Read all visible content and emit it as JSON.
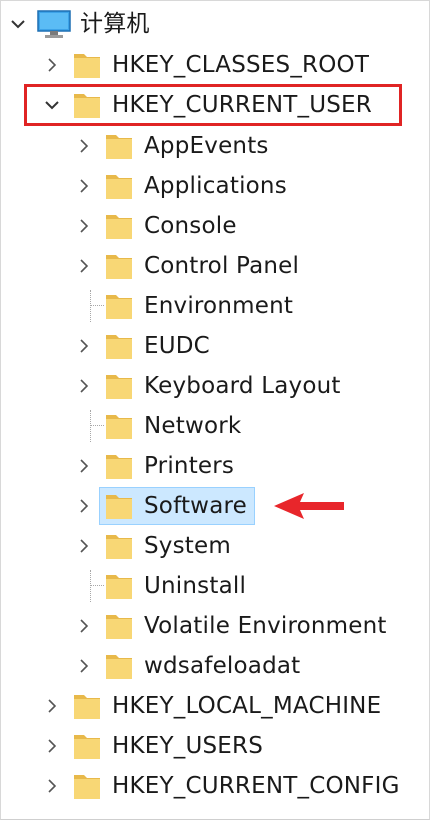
{
  "tree": {
    "root": {
      "label": "计算机",
      "icon": "computer-icon",
      "expanded": true
    },
    "hives": [
      {
        "label": "HKEY_CLASSES_ROOT",
        "expanded": false
      },
      {
        "label": "HKEY_CURRENT_USER",
        "expanded": true,
        "highlighted": true
      },
      {
        "label": "HKEY_LOCAL_MACHINE",
        "expanded": false
      },
      {
        "label": "HKEY_USERS",
        "expanded": false
      },
      {
        "label": "HKEY_CURRENT_CONFIG",
        "expanded": false
      }
    ],
    "current_user_children": [
      {
        "label": "AppEvents",
        "has_children": true
      },
      {
        "label": "Applications",
        "has_children": true
      },
      {
        "label": "Console",
        "has_children": true
      },
      {
        "label": "Control Panel",
        "has_children": true
      },
      {
        "label": "Environment",
        "has_children": false
      },
      {
        "label": "EUDC",
        "has_children": true
      },
      {
        "label": "Keyboard Layout",
        "has_children": true
      },
      {
        "label": "Network",
        "has_children": false
      },
      {
        "label": "Printers",
        "has_children": true
      },
      {
        "label": "Software",
        "has_children": true,
        "selected": true
      },
      {
        "label": "System",
        "has_children": true
      },
      {
        "label": "Uninstall",
        "has_children": false
      },
      {
        "label": "Volatile Environment",
        "has_children": true
      },
      {
        "label": "wdsafeloadat",
        "has_children": true
      }
    ]
  },
  "colors": {
    "folder": "#f8d775",
    "folder_dark": "#e8b94a",
    "selection": "#cce8ff",
    "highlight_box": "#e02424",
    "arrow": "#e8262b"
  }
}
